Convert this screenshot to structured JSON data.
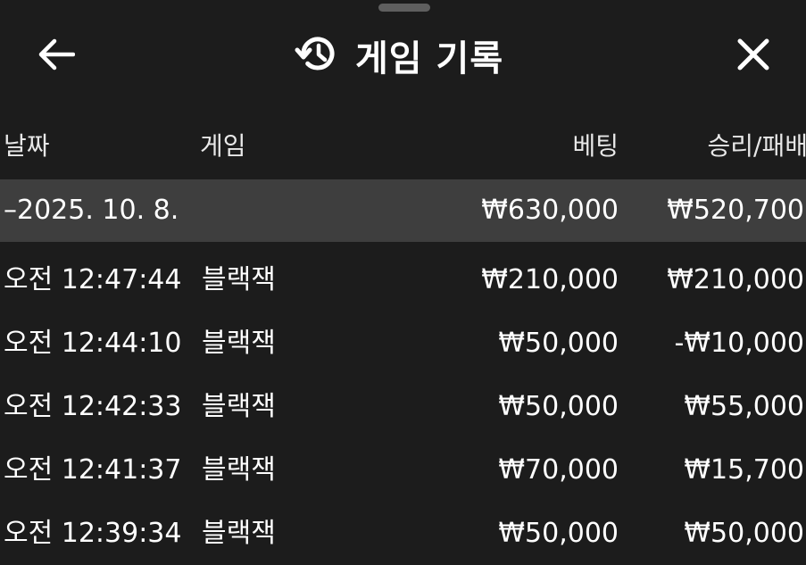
{
  "header": {
    "title": "게임 기록",
    "back_icon": "arrow-left-icon",
    "history_icon": "history-icon",
    "close_icon": "close-icon"
  },
  "columns": {
    "date": "날짜",
    "game": "게임",
    "bet": "베팅",
    "result": "승리/패배"
  },
  "summary": {
    "date": "–2025. 10. 8.",
    "bet": "₩630,000",
    "result": "₩520,700"
  },
  "rows": [
    {
      "time": "오전 12:47:44",
      "game": "블랙잭",
      "bet": "₩210,000",
      "result": "₩210,000"
    },
    {
      "time": "오전 12:44:10",
      "game": "블랙잭",
      "bet": "₩50,000",
      "result": "-₩10,000"
    },
    {
      "time": "오전 12:42:33",
      "game": "블랙잭",
      "bet": "₩50,000",
      "result": "₩55,000"
    },
    {
      "time": "오전 12:41:37",
      "game": "블랙잭",
      "bet": "₩70,000",
      "result": "₩15,700"
    },
    {
      "time": "오전 12:39:34",
      "game": "블랙잭",
      "bet": "₩50,000",
      "result": "₩50,000"
    }
  ],
  "colors": {
    "background": "#1c1c1c",
    "summary_row": "#3e3e3e",
    "text": "#ffffff"
  }
}
